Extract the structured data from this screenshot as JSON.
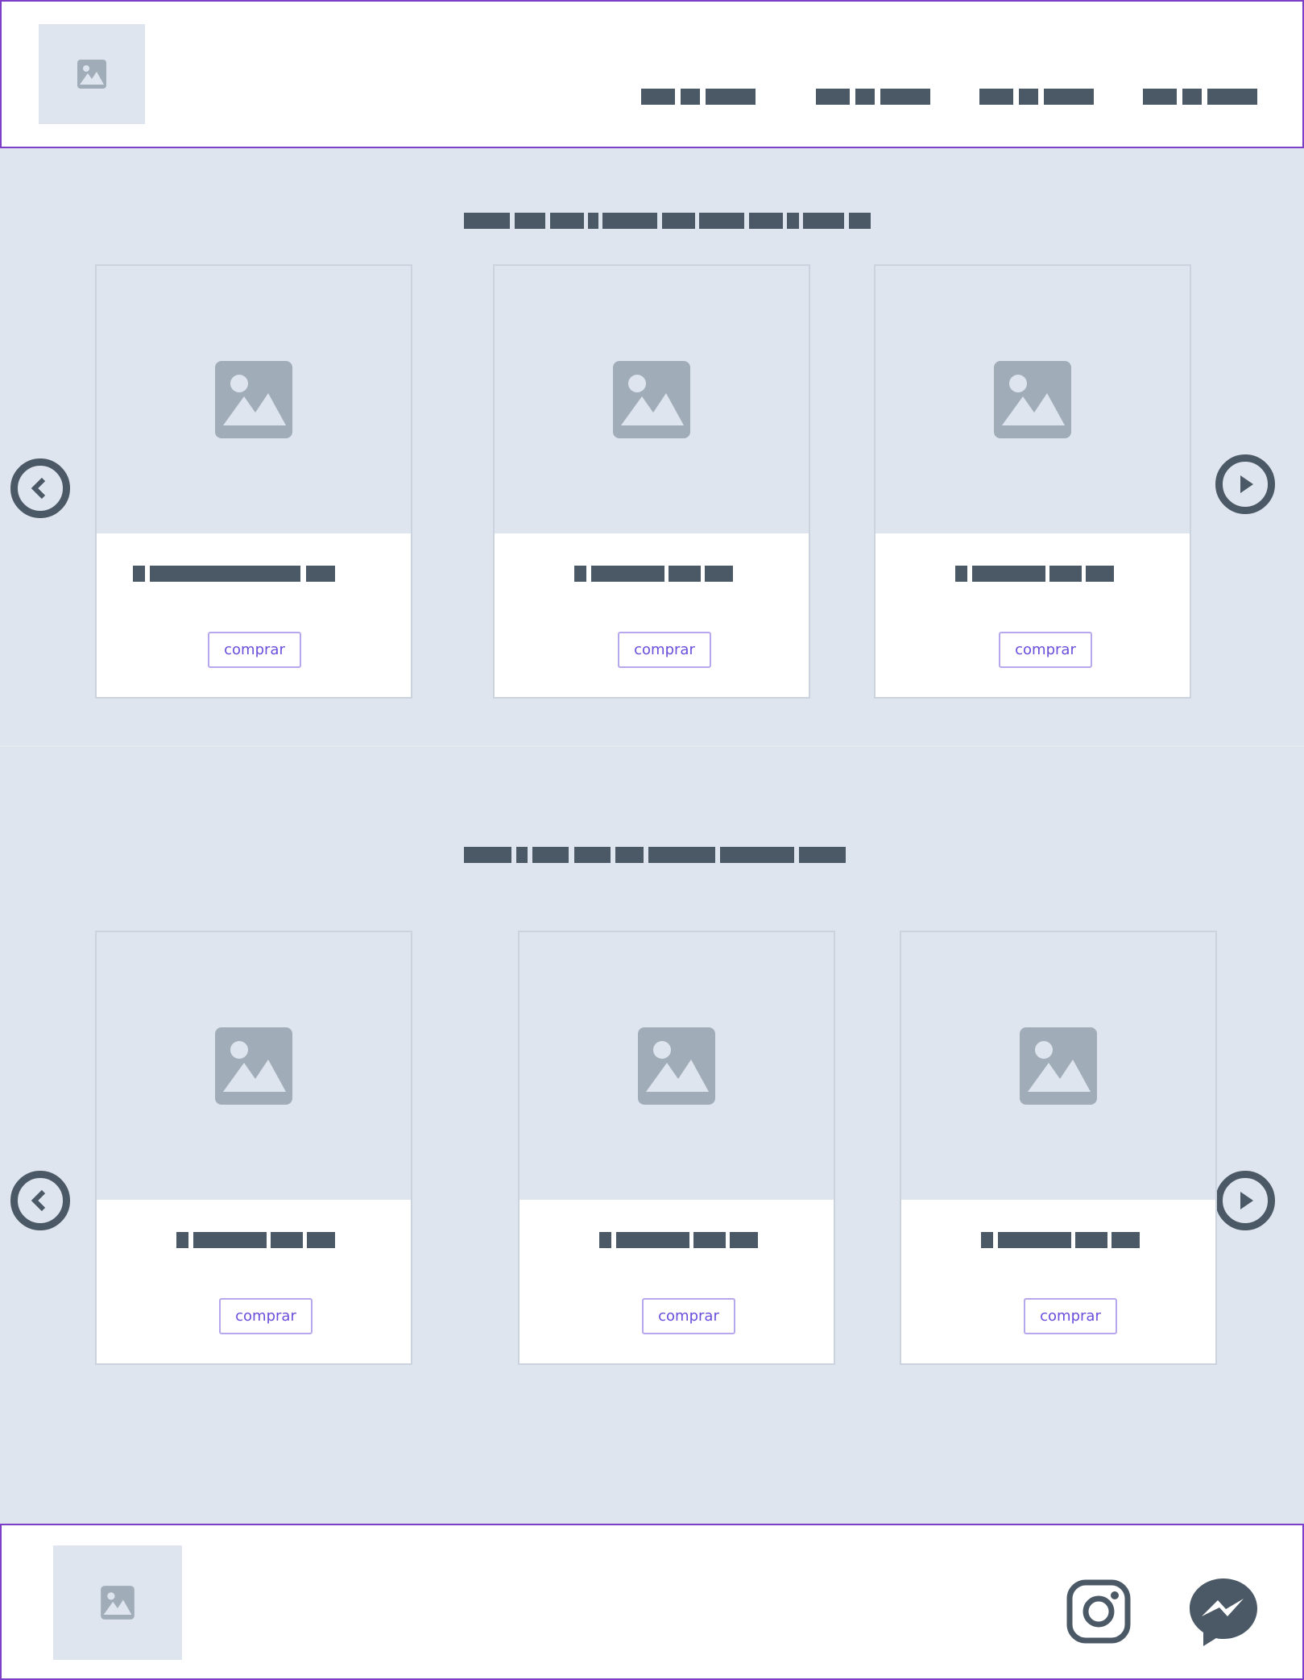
{
  "sections": [
    {
      "products": [
        {
          "button": "comprar"
        },
        {
          "button": "comprar"
        },
        {
          "button": "comprar"
        }
      ]
    },
    {
      "products": [
        {
          "button": "comprar"
        },
        {
          "button": "comprar"
        },
        {
          "button": "comprar"
        }
      ]
    }
  ],
  "colors": {
    "frame": "#7e3fc8",
    "placeholder_bar": "#4b5966",
    "background": "#dfe5ee",
    "button_text": "#6a4ddd"
  },
  "icons": {
    "logo": "image-icon",
    "prev": "chevron-left-circle-icon",
    "next": "play-circle-icon",
    "social_1": "instagram-icon",
    "social_2": "messenger-icon"
  }
}
